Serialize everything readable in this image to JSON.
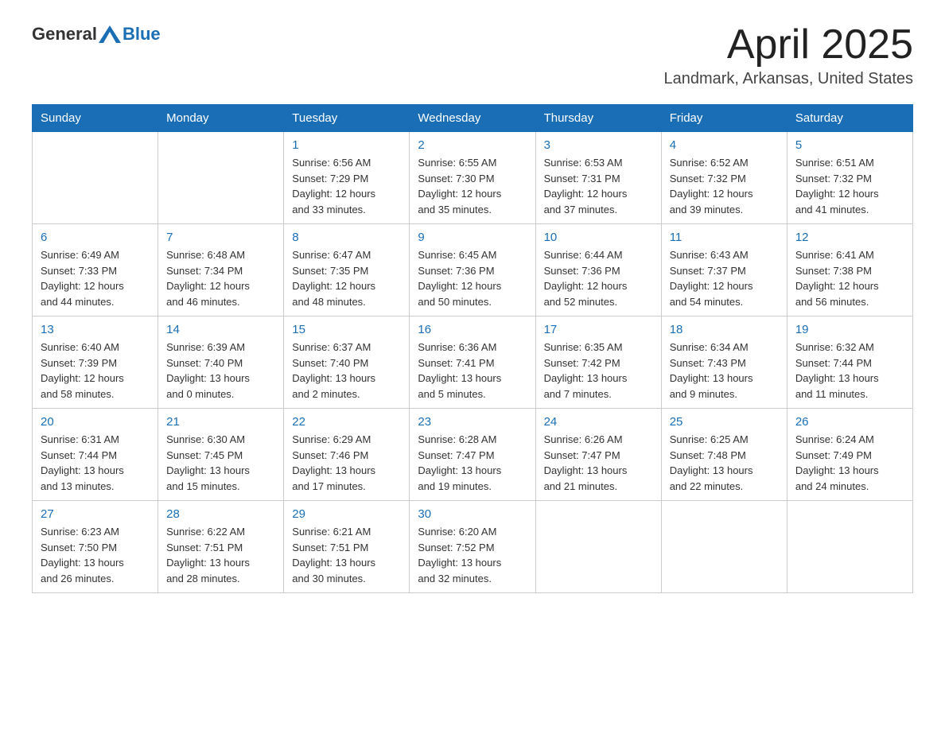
{
  "header": {
    "logo_general": "General",
    "logo_blue": "Blue",
    "month_title": "April 2025",
    "location": "Landmark, Arkansas, United States"
  },
  "days_of_week": [
    "Sunday",
    "Monday",
    "Tuesday",
    "Wednesday",
    "Thursday",
    "Friday",
    "Saturday"
  ],
  "weeks": [
    [
      {
        "day": "",
        "info": ""
      },
      {
        "day": "",
        "info": ""
      },
      {
        "day": "1",
        "info": "Sunrise: 6:56 AM\nSunset: 7:29 PM\nDaylight: 12 hours\nand 33 minutes."
      },
      {
        "day": "2",
        "info": "Sunrise: 6:55 AM\nSunset: 7:30 PM\nDaylight: 12 hours\nand 35 minutes."
      },
      {
        "day": "3",
        "info": "Sunrise: 6:53 AM\nSunset: 7:31 PM\nDaylight: 12 hours\nand 37 minutes."
      },
      {
        "day": "4",
        "info": "Sunrise: 6:52 AM\nSunset: 7:32 PM\nDaylight: 12 hours\nand 39 minutes."
      },
      {
        "day": "5",
        "info": "Sunrise: 6:51 AM\nSunset: 7:32 PM\nDaylight: 12 hours\nand 41 minutes."
      }
    ],
    [
      {
        "day": "6",
        "info": "Sunrise: 6:49 AM\nSunset: 7:33 PM\nDaylight: 12 hours\nand 44 minutes."
      },
      {
        "day": "7",
        "info": "Sunrise: 6:48 AM\nSunset: 7:34 PM\nDaylight: 12 hours\nand 46 minutes."
      },
      {
        "day": "8",
        "info": "Sunrise: 6:47 AM\nSunset: 7:35 PM\nDaylight: 12 hours\nand 48 minutes."
      },
      {
        "day": "9",
        "info": "Sunrise: 6:45 AM\nSunset: 7:36 PM\nDaylight: 12 hours\nand 50 minutes."
      },
      {
        "day": "10",
        "info": "Sunrise: 6:44 AM\nSunset: 7:36 PM\nDaylight: 12 hours\nand 52 minutes."
      },
      {
        "day": "11",
        "info": "Sunrise: 6:43 AM\nSunset: 7:37 PM\nDaylight: 12 hours\nand 54 minutes."
      },
      {
        "day": "12",
        "info": "Sunrise: 6:41 AM\nSunset: 7:38 PM\nDaylight: 12 hours\nand 56 minutes."
      }
    ],
    [
      {
        "day": "13",
        "info": "Sunrise: 6:40 AM\nSunset: 7:39 PM\nDaylight: 12 hours\nand 58 minutes."
      },
      {
        "day": "14",
        "info": "Sunrise: 6:39 AM\nSunset: 7:40 PM\nDaylight: 13 hours\nand 0 minutes."
      },
      {
        "day": "15",
        "info": "Sunrise: 6:37 AM\nSunset: 7:40 PM\nDaylight: 13 hours\nand 2 minutes."
      },
      {
        "day": "16",
        "info": "Sunrise: 6:36 AM\nSunset: 7:41 PM\nDaylight: 13 hours\nand 5 minutes."
      },
      {
        "day": "17",
        "info": "Sunrise: 6:35 AM\nSunset: 7:42 PM\nDaylight: 13 hours\nand 7 minutes."
      },
      {
        "day": "18",
        "info": "Sunrise: 6:34 AM\nSunset: 7:43 PM\nDaylight: 13 hours\nand 9 minutes."
      },
      {
        "day": "19",
        "info": "Sunrise: 6:32 AM\nSunset: 7:44 PM\nDaylight: 13 hours\nand 11 minutes."
      }
    ],
    [
      {
        "day": "20",
        "info": "Sunrise: 6:31 AM\nSunset: 7:44 PM\nDaylight: 13 hours\nand 13 minutes."
      },
      {
        "day": "21",
        "info": "Sunrise: 6:30 AM\nSunset: 7:45 PM\nDaylight: 13 hours\nand 15 minutes."
      },
      {
        "day": "22",
        "info": "Sunrise: 6:29 AM\nSunset: 7:46 PM\nDaylight: 13 hours\nand 17 minutes."
      },
      {
        "day": "23",
        "info": "Sunrise: 6:28 AM\nSunset: 7:47 PM\nDaylight: 13 hours\nand 19 minutes."
      },
      {
        "day": "24",
        "info": "Sunrise: 6:26 AM\nSunset: 7:47 PM\nDaylight: 13 hours\nand 21 minutes."
      },
      {
        "day": "25",
        "info": "Sunrise: 6:25 AM\nSunset: 7:48 PM\nDaylight: 13 hours\nand 22 minutes."
      },
      {
        "day": "26",
        "info": "Sunrise: 6:24 AM\nSunset: 7:49 PM\nDaylight: 13 hours\nand 24 minutes."
      }
    ],
    [
      {
        "day": "27",
        "info": "Sunrise: 6:23 AM\nSunset: 7:50 PM\nDaylight: 13 hours\nand 26 minutes."
      },
      {
        "day": "28",
        "info": "Sunrise: 6:22 AM\nSunset: 7:51 PM\nDaylight: 13 hours\nand 28 minutes."
      },
      {
        "day": "29",
        "info": "Sunrise: 6:21 AM\nSunset: 7:51 PM\nDaylight: 13 hours\nand 30 minutes."
      },
      {
        "day": "30",
        "info": "Sunrise: 6:20 AM\nSunset: 7:52 PM\nDaylight: 13 hours\nand 32 minutes."
      },
      {
        "day": "",
        "info": ""
      },
      {
        "day": "",
        "info": ""
      },
      {
        "day": "",
        "info": ""
      }
    ]
  ]
}
